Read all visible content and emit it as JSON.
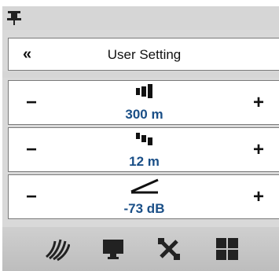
{
  "header": {
    "title": "User Setting",
    "back_label": "«"
  },
  "controls": [
    {
      "icon": "range-bars-icon",
      "value": "300 m",
      "minus": "−",
      "plus": "+"
    },
    {
      "icon": "step-bars-icon",
      "value": "12 m",
      "minus": "−",
      "plus": "+"
    },
    {
      "icon": "gain-slope-icon",
      "value": "-73 dB",
      "minus": "−",
      "plus": "+"
    }
  ],
  "toolbar": [
    "sonar-icon",
    "monitor-icon",
    "tools-icon",
    "grid-icon"
  ],
  "colors": {
    "value_text": "#1a4f87",
    "panel_bg": "#d9d9d9"
  }
}
